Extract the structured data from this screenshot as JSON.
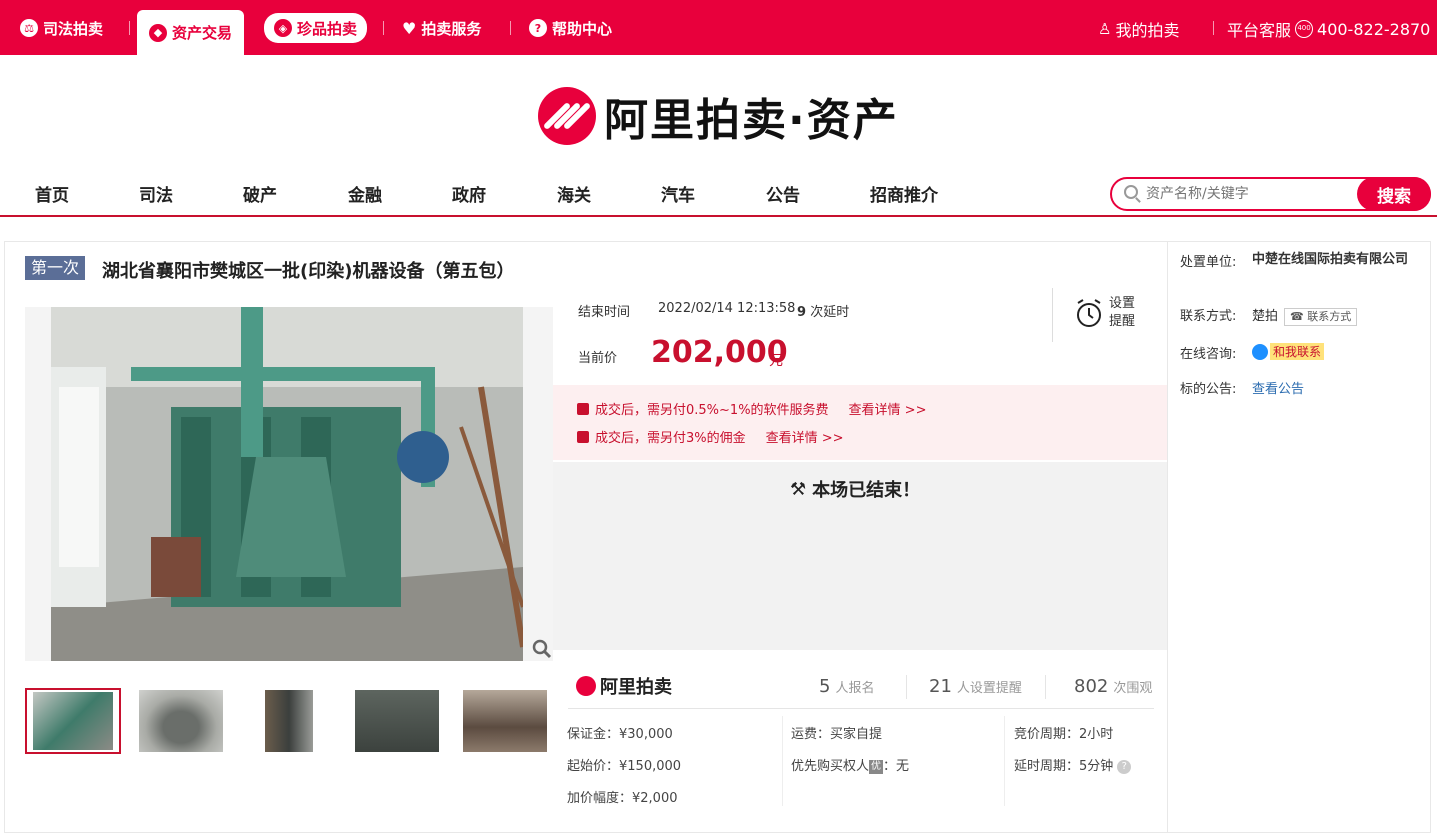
{
  "topbar": {
    "tabs": [
      {
        "label": "司法拍卖",
        "icon": "judicial-icon"
      },
      {
        "label": "资产交易",
        "icon": "asset-icon"
      },
      {
        "label": "珍品拍卖",
        "icon": "treasure-icon"
      },
      {
        "label": "拍卖服务",
        "icon": "heart-icon"
      },
      {
        "label": "帮助中心",
        "icon": "help-icon"
      }
    ],
    "my_auction": "我的拍卖",
    "service_label": "平台客服",
    "service_phone": "400-822-2870"
  },
  "logo": {
    "text": "阿里拍卖·资产"
  },
  "nav": {
    "items": [
      "首页",
      "司法",
      "破产",
      "金融",
      "政府",
      "海关",
      "汽车",
      "公告",
      "招商推介"
    ]
  },
  "search": {
    "placeholder": "资产名称/关键字",
    "button": "搜索"
  },
  "item": {
    "round": "第一次",
    "title": "湖北省襄阳市樊城区一批(印染)机器设备（第五包）",
    "end_label": "结束时间",
    "end_time": "2022/02/14 12:13:58",
    "delay_count": "9",
    "delay_label": "次延时",
    "reminder": "设置提醒",
    "current_label": "当前价",
    "current_price": "202,000",
    "current_unit": "元",
    "notices": [
      {
        "text": "成交后，需另付0.5%~1%的软件服务费",
        "link": "查看详情 >>"
      },
      {
        "text": "成交后，需另付3%的佣金",
        "link": "查看详情 >>"
      }
    ],
    "ended_text": "本场已结束！",
    "brand": "阿里拍卖",
    "stats": [
      {
        "num": "5",
        "label": "人报名"
      },
      {
        "num": "21",
        "label": "人设置提醒"
      },
      {
        "num": "802",
        "label": "次围观"
      }
    ],
    "details": {
      "deposit": "保证金：¥30,000",
      "start_price": "起始价：¥150,000",
      "increment": "加价幅度：¥2,000",
      "freight": "运费：买家自提",
      "priority_label": "优先购买权人",
      "priority_badge": "优",
      "priority_value": "：无",
      "cycle": "竞价周期：2小时",
      "extend": "延时周期：5分钟"
    }
  },
  "seller": {
    "org_label": "处置单位:",
    "org": "中楚在线国际拍卖有限公司",
    "contact_label": "联系方式:",
    "contact_name": "楚拍",
    "contact_btn": "联系方式",
    "chat_label": "在线咨询:",
    "chat_btn": "和我联系",
    "notice_label": "标的公告:",
    "notice_link": "查看公告"
  },
  "colors": {
    "brand": "#e8003c",
    "price": "#c8102e",
    "badge": "#5b6e97"
  }
}
